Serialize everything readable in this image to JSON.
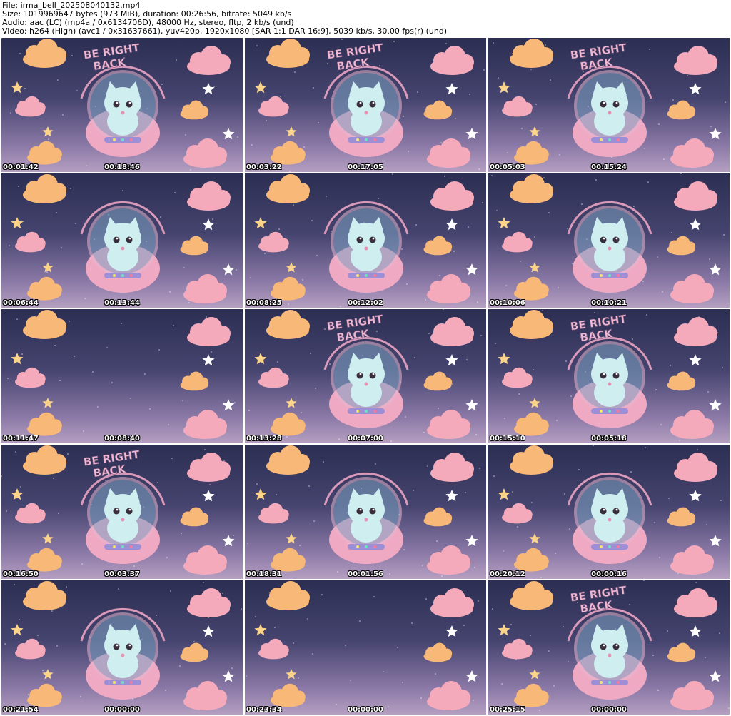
{
  "header": {
    "file": "File: irma_bell_202508040132.mp4",
    "size": "Size: 1019969647 bytes (973 MiB), duration: 00:26:56, bitrate: 5049 kb/s",
    "audio": "Audio: aac (LC) (mp4a / 0x6134706D), 48000 Hz, stereo, fltp, 2 kb/s (und)",
    "video": "Video: h264 (High) (avc1 / 0x31637661), yuv420p, 1920x1080 [SAR 1:1 DAR 16:9], 5039 kb/s, 30.00 fps(r) (und)"
  },
  "sign_text": [
    "BE RIGHT",
    "BACK"
  ],
  "colors": {
    "sky_top": "#2c2e52",
    "sky_bottom": "#b59fc1",
    "cloud_orange": "#f8b878",
    "cloud_pink": "#f4aabb",
    "star_yellow": "#fbd48a",
    "cat": "#cfeef0",
    "pod": "#f0a9c3"
  },
  "thumbnails": [
    {
      "time": "00:01:42",
      "remaining": "00:18:46",
      "cat": true,
      "sign": true
    },
    {
      "time": "00:03:22",
      "remaining": "00:17:05",
      "cat": true,
      "sign": true
    },
    {
      "time": "00:05:03",
      "remaining": "00:15:24",
      "cat": true,
      "sign": true
    },
    {
      "time": "00:06:44",
      "remaining": "00:13:44",
      "cat": true,
      "sign": false
    },
    {
      "time": "00:08:25",
      "remaining": "00:12:02",
      "cat": true,
      "sign": false
    },
    {
      "time": "00:10:06",
      "remaining": "00:10:21",
      "cat": true,
      "sign": false
    },
    {
      "time": "00:11:47",
      "remaining": "00:08:40",
      "cat": false,
      "sign": false
    },
    {
      "time": "00:13:28",
      "remaining": "00:07:00",
      "cat": true,
      "sign": true
    },
    {
      "time": "00:15:10",
      "remaining": "00:05:18",
      "cat": true,
      "sign": true
    },
    {
      "time": "00:16:50",
      "remaining": "00:03:37",
      "cat": true,
      "sign": true
    },
    {
      "time": "00:18:31",
      "remaining": "00:01:56",
      "cat": true,
      "sign": false
    },
    {
      "time": "00:20:12",
      "remaining": "00:00:16",
      "cat": true,
      "sign": false
    },
    {
      "time": "00:21:54",
      "remaining": "00:00:00",
      "cat": true,
      "sign": false
    },
    {
      "time": "00:23:34",
      "remaining": "00:00:00",
      "cat": false,
      "sign": false
    },
    {
      "time": "00:25:15",
      "remaining": "00:00:00",
      "cat": true,
      "sign": true
    }
  ]
}
